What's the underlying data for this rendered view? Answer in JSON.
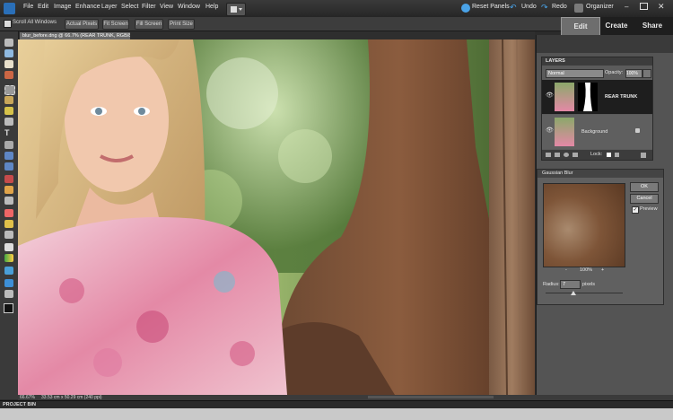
{
  "menu": {
    "items": [
      "File",
      "Edit",
      "Image",
      "Enhance",
      "Layer",
      "Select",
      "Filter",
      "View",
      "Window",
      "Help"
    ]
  },
  "top_commands": {
    "reset_panels": "Reset Panels",
    "undo": "Undo",
    "redo": "Redo",
    "organizer": "Organizer"
  },
  "mode_tabs": [
    "Edit",
    "Create",
    "Share"
  ],
  "options_bar": {
    "scroll_all_windows": "Scroll All Windows",
    "actual_pixels": "Actual Pixels",
    "fit_screen": "Fit Screen",
    "fill_screen": "Fill Screen",
    "print_size": "Print Size"
  },
  "document_tab": "blur_before.dng @ 66.7% (REAR TRUNK, RGB/8) *",
  "layers_panel": {
    "title": "LAYERS",
    "blend_mode": "Normal",
    "opacity_label": "Opacity:",
    "opacity_value": "100%",
    "layers": [
      {
        "name": "REAR TRUNK"
      },
      {
        "name": "Background"
      }
    ],
    "lock_label": "Lock:"
  },
  "gaussian_blur": {
    "title": "Gaussian Blur",
    "ok_label": "OK",
    "cancel_label": "Cancel",
    "preview_label": "Preview",
    "preview_checked": true,
    "zoom": "100%",
    "zoom_minus": "-",
    "zoom_plus": "+",
    "radius_label": "Radius:",
    "radius_value": "7",
    "radius_unit": "pixels"
  },
  "status": {
    "zoom": "66.67%",
    "doc_info": "33.53 cm x 50.29 cm (240 ppi)"
  },
  "project_bin": "PROJECT BIN",
  "colors": {
    "accent": "#2a6fb8"
  }
}
